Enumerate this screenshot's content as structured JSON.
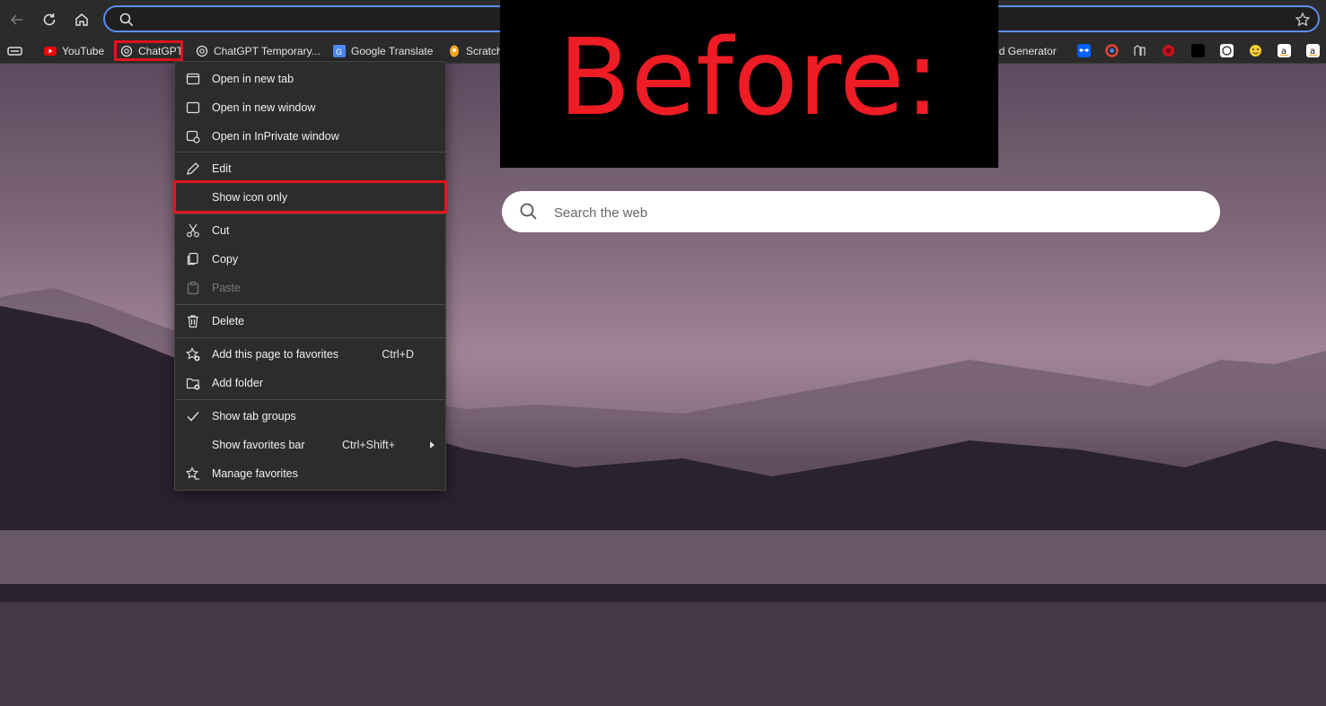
{
  "address_bar": {
    "value": ""
  },
  "favorites": [
    {
      "label": "YouTube",
      "icon": "youtube-icon"
    },
    {
      "label": "ChatGPT",
      "icon": "openai-icon"
    },
    {
      "label": "ChatGPT Temporary...",
      "icon": "openai-icon"
    },
    {
      "label": "Google Translate",
      "icon": "google-translate-icon"
    },
    {
      "label": "Scratch",
      "icon": "scratch-icon"
    },
    {
      "label": "ord Generator",
      "icon": ""
    }
  ],
  "banner": {
    "text": "Before:"
  },
  "search": {
    "placeholder": "Search the web"
  },
  "context_menu": {
    "open_new_tab": "Open in new tab",
    "open_new_window": "Open in new window",
    "open_inprivate": "Open in InPrivate window",
    "edit": "Edit",
    "show_icon_only": "Show icon only",
    "cut": "Cut",
    "copy": "Copy",
    "paste": "Paste",
    "delete": "Delete",
    "add_page": "Add this page to favorites",
    "add_page_shortcut": "Ctrl+D",
    "add_folder": "Add folder",
    "show_tab_groups": "Show tab groups",
    "show_favorites_bar": "Show favorites bar",
    "show_favorites_bar_shortcut": "Ctrl+Shift+",
    "manage_favorites": "Manage favorites"
  },
  "colors": {
    "highlight": "#e4141c",
    "banner_text": "#ee1c25",
    "address_border": "#5b8def"
  }
}
